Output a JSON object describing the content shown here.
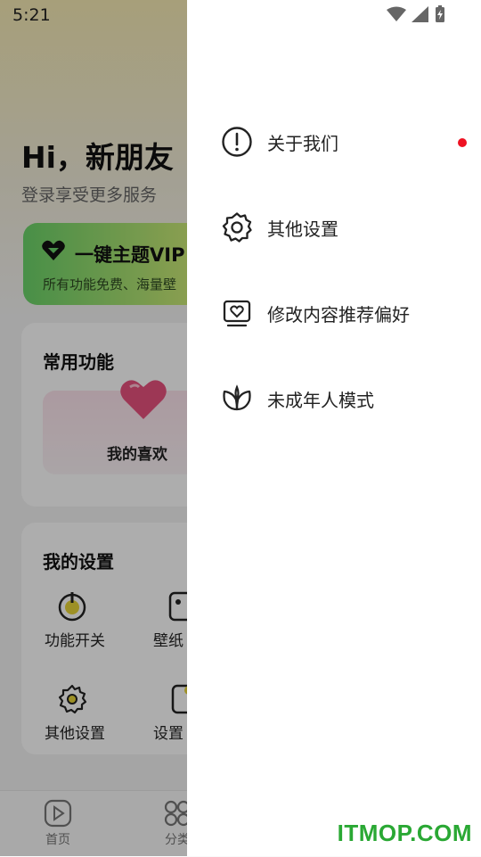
{
  "status_bar": {
    "time": "5:21"
  },
  "background": {
    "greeting": "Hi，新朋友",
    "greeting_sub": "登录享受更多服务",
    "vip": {
      "title": "一键主题VIP",
      "subtitle": "所有功能免费、海量壁"
    },
    "common": {
      "title": "常用功能",
      "favorite_label": "我的喜欢"
    },
    "settings": {
      "title": "我的设置",
      "items": [
        {
          "label": "功能开关"
        },
        {
          "label": "壁纸"
        },
        {
          "label": "其他设置"
        },
        {
          "label": "设置"
        }
      ]
    },
    "tabs": [
      {
        "label": "首页"
      },
      {
        "label": "分类"
      }
    ]
  },
  "drawer": {
    "items": [
      {
        "label": "关于我们",
        "icon": "info-icon",
        "has_badge": true
      },
      {
        "label": "其他设置",
        "icon": "gear-icon"
      },
      {
        "label": "修改内容推荐偏好",
        "icon": "tv-heart-icon"
      },
      {
        "label": "未成年人模式",
        "icon": "sprout-icon"
      }
    ],
    "badge_color": "#ee1122"
  },
  "watermark": "ITMOP.COM"
}
